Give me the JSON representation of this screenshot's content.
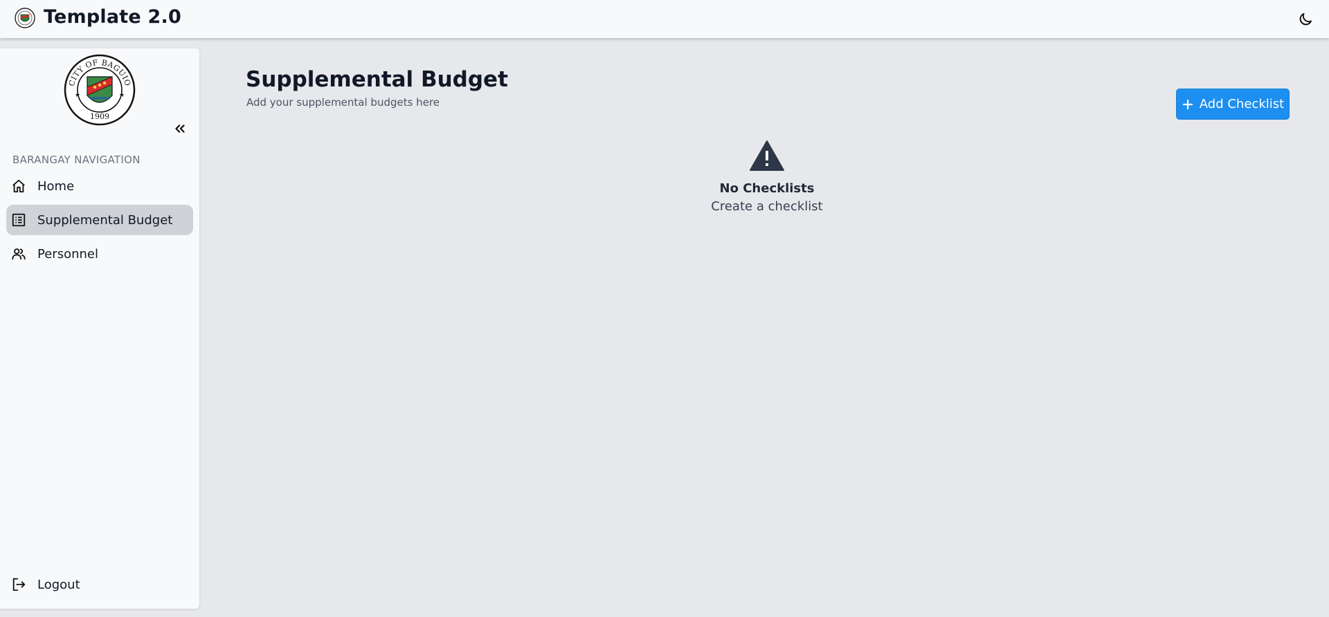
{
  "app": {
    "title": "Template 2.0"
  },
  "topbar": {
    "logo_icon": "city-seal-icon",
    "theme_icon": "moon-icon"
  },
  "sidebar": {
    "seal_icon": "city-of-baguio-seal",
    "seal_text_top": "CITY OF BAGUIO",
    "seal_year": "1909",
    "collapse_icon": "double-chevron-left-icon",
    "heading": "BARANGAY NAVIGATION",
    "items": [
      {
        "label": "Home",
        "icon": "home-icon",
        "active": false
      },
      {
        "label": "Supplemental Budget",
        "icon": "list-icon",
        "active": true
      },
      {
        "label": "Personnel",
        "icon": "users-icon",
        "active": false
      }
    ],
    "logout": {
      "label": "Logout",
      "icon": "logout-icon"
    }
  },
  "main": {
    "title": "Supplemental Budget",
    "subtitle": "Add your supplemental budgets here",
    "add_button": {
      "label": "Add Checklist",
      "icon": "plus-icon"
    },
    "empty_state": {
      "icon": "warning-icon",
      "title": "No Checklists",
      "subtitle": "Create a checklist"
    }
  },
  "colors": {
    "accent": "#1d8ff0",
    "background": "#e7e8eb",
    "surface": "#f8f9fa",
    "active_nav": "#cfd2d6"
  }
}
